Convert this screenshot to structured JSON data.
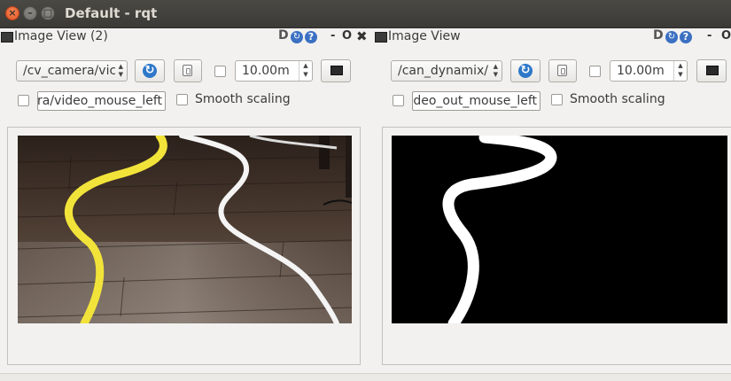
{
  "window": {
    "title": "Default - rqt",
    "close_glyph": "×",
    "minimize_glyph": "–",
    "maximize_glyph": "□"
  },
  "left_pane": {
    "title": "Image View (2)",
    "topic": "/cv_camera/vic",
    "zoom_value": "10.00m",
    "mouse_topic": "ra/video_mouse_left",
    "smooth_label": "Smooth scaling"
  },
  "right_pane": {
    "title": "Image View",
    "topic": "/can_dynamix/",
    "zoom_value": "10.00m",
    "mouse_topic": "deo_out_mouse_left",
    "smooth_label": "Smooth scaling"
  },
  "plugin_controls": {
    "d_label": "D",
    "reload_glyph": "↻",
    "help_glyph": "?",
    "dash_label": "-",
    "o_label": "O",
    "close_glyph": "✖"
  },
  "icons": {
    "refresh": "↻",
    "combo_arrows": "▲▼",
    "spin_up": "▲",
    "spin_down": "▼"
  },
  "colors": {
    "titlebar": "#3b3a36",
    "close_button": "#e2531f",
    "accent_blue": "#3b70c2",
    "yellow_line": "#f2e33a"
  }
}
